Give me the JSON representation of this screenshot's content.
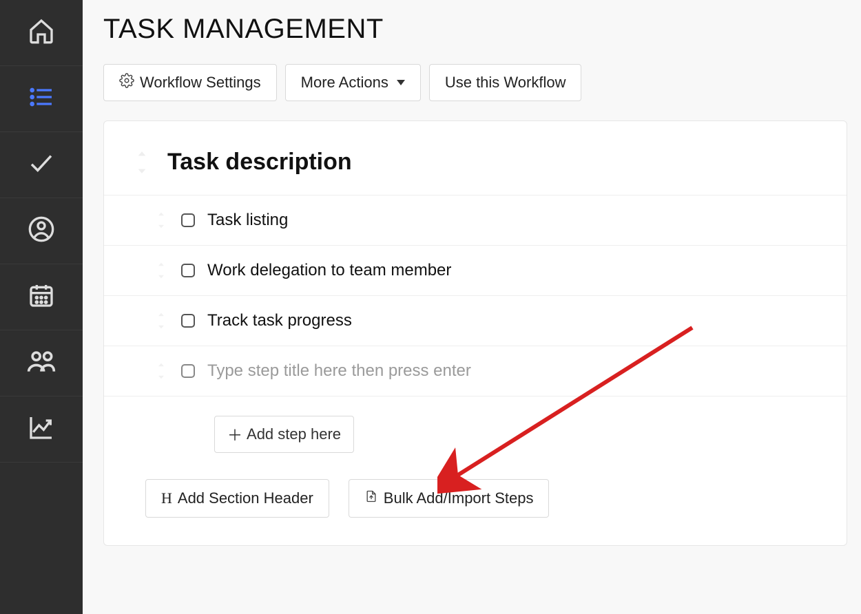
{
  "page": {
    "title": "TASK MANAGEMENT"
  },
  "toolbar": {
    "workflow_settings": "Workflow Settings",
    "more_actions": "More Actions",
    "use_workflow": "Use this Workflow"
  },
  "section": {
    "title": "Task description"
  },
  "steps": [
    {
      "label": "Task listing"
    },
    {
      "label": "Work delegation to team member"
    },
    {
      "label": "Track task progress"
    }
  ],
  "new_step": {
    "placeholder": "Type step title here then press enter"
  },
  "actions": {
    "add_step_here": "Add step here",
    "add_section_header": "Add Section Header",
    "bulk_add": "Bulk Add/Import Steps"
  },
  "colors": {
    "annotation": "#d82020"
  }
}
